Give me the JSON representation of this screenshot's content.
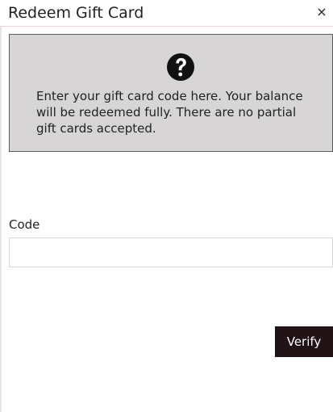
{
  "dialog": {
    "title": "Redeem Gift Card",
    "close_symbol": "×",
    "close_icon": "close-icon"
  },
  "info": {
    "icon": "question-icon",
    "icon_color": "#111111",
    "message": "Enter your gift card code here. Your balance will be redeemed fully. There are no partial gift cards accepted."
  },
  "form": {
    "code_label": "Code",
    "code_value": "",
    "code_placeholder": "",
    "verify_label": "Verify"
  },
  "colors": {
    "info_background": "#d7d5d6",
    "info_border": "#5d5d5d",
    "button_background": "#211315",
    "button_text": "#ffffff"
  }
}
